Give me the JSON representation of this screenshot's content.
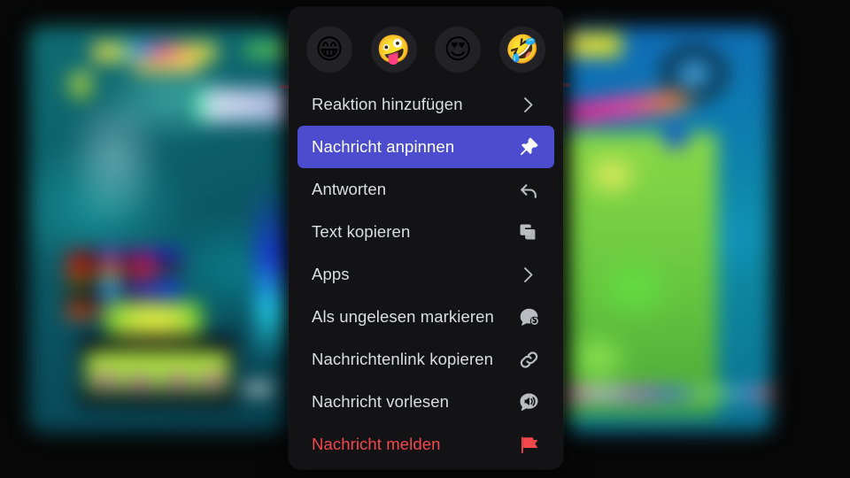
{
  "background": {
    "description": "blurred photo of two tablet screens showing a colorful game",
    "left_screen_name": "game-screen-left",
    "right_screen_name": "game-screen-right"
  },
  "context_menu": {
    "reactions": [
      {
        "name": "reaction-grinning-squinting",
        "glyph": "😁",
        "label": "Grinsendes Gesicht"
      },
      {
        "name": "reaction-zany-face",
        "glyph": "🤪",
        "label": "Albernes Gesicht"
      },
      {
        "name": "reaction-heart-eyes",
        "glyph": "😍",
        "label": "Smiley mit Herzaugen"
      },
      {
        "name": "reaction-rofl",
        "glyph": "🤣",
        "label": "Sich vor Lachen kugeln"
      }
    ],
    "items": [
      {
        "name": "add-reaction",
        "label": "Reaktion hinzufügen",
        "icon": "chevron-right-icon",
        "state": "normal"
      },
      {
        "name": "pin-message",
        "label": "Nachricht anpinnen",
        "icon": "pin-icon",
        "state": "selected"
      },
      {
        "name": "reply",
        "label": "Antworten",
        "icon": "reply-arrow-icon",
        "state": "normal"
      },
      {
        "name": "copy-text",
        "label": "Text kopieren",
        "icon": "copy-icon",
        "state": "normal"
      },
      {
        "name": "apps",
        "label": "Apps",
        "icon": "chevron-right-icon",
        "state": "normal"
      },
      {
        "name": "mark-unread",
        "label": "Als ungelesen markieren",
        "icon": "mark-unread-icon",
        "state": "normal"
      },
      {
        "name": "copy-message-link",
        "label": "Nachrichtenlink kopieren",
        "icon": "link-icon",
        "state": "normal"
      },
      {
        "name": "read-message-aloud",
        "label": "Nachricht vorlesen",
        "icon": "speaker-bubble-icon",
        "state": "normal"
      },
      {
        "name": "report-message",
        "label": "Nachricht melden",
        "icon": "flag-icon",
        "state": "danger"
      }
    ]
  },
  "colors": {
    "menu_background": "#131316",
    "selected_highlight": "#4b4cce",
    "text": "#dbdee1",
    "danger_text": "#f2484b",
    "reaction_pill": "#222226",
    "page_background": "#0a0a0a"
  }
}
